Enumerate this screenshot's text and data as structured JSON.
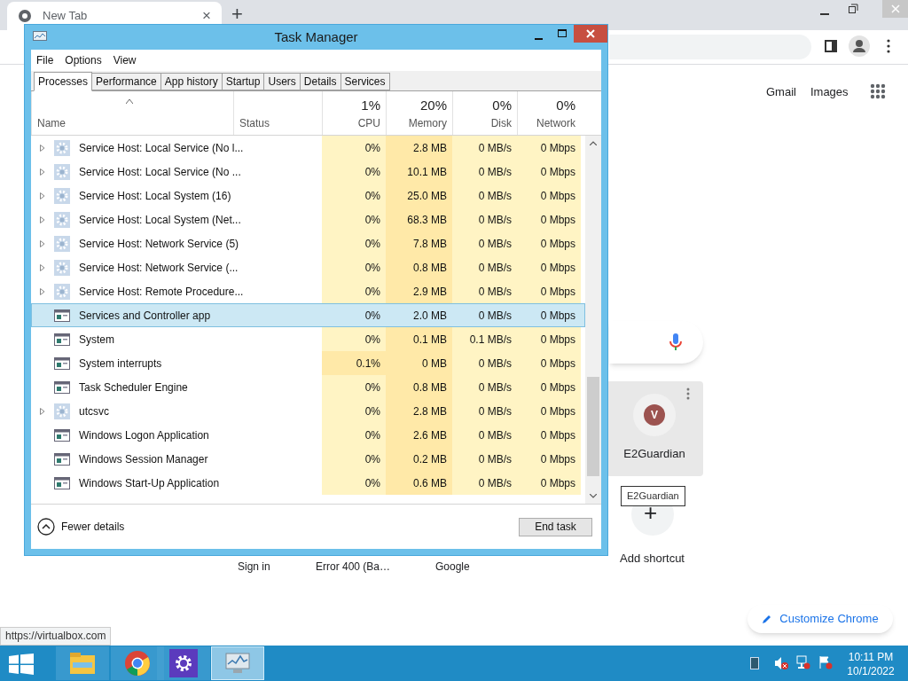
{
  "browser": {
    "tab": {
      "title": "New Tab",
      "close": "×"
    },
    "new_tab": "+",
    "top_links": [
      "Gmail",
      "Images"
    ],
    "shortcut": {
      "avatar": "V",
      "title": "E2Guardian",
      "tooltip": "E2Guardian"
    },
    "add_shortcut": "+",
    "add_shortcut_label": "Add shortcut",
    "hidden_shortcuts": [
      "Sign in",
      "Error 400 (Ba…",
      "Google"
    ],
    "customize": "Customize Chrome",
    "status_url": "https://virtualbox.com"
  },
  "task_manager": {
    "title": "Task Manager",
    "menu": [
      "File",
      "Options",
      "View"
    ],
    "tabs": [
      {
        "label": "Processes",
        "selected": true
      },
      {
        "label": "Performance",
        "selected": false
      },
      {
        "label": "App history",
        "selected": false
      },
      {
        "label": "Startup",
        "selected": false
      },
      {
        "label": "Users",
        "selected": false
      },
      {
        "label": "Details",
        "selected": false
      },
      {
        "label": "Services",
        "selected": false
      }
    ],
    "columns": [
      {
        "label": "Name"
      },
      {
        "label": "Status"
      },
      {
        "label": "CPU",
        "total": "1%"
      },
      {
        "label": "Memory",
        "total": "20%"
      },
      {
        "label": "Disk",
        "total": "0%"
      },
      {
        "label": "Network",
        "total": "0%"
      }
    ],
    "rows": [
      {
        "kind": "service",
        "name": "Service Host: Local Service (No l...",
        "cpu": "0%",
        "memory": "2.8 MB",
        "disk": "0 MB/s",
        "network": "0 Mbps",
        "selected": false
      },
      {
        "kind": "service",
        "name": "Service Host: Local Service (No ...",
        "cpu": "0%",
        "memory": "10.1 MB",
        "disk": "0 MB/s",
        "network": "0 Mbps",
        "selected": false
      },
      {
        "kind": "service",
        "name": "Service Host: Local System (16)",
        "cpu": "0%",
        "memory": "25.0 MB",
        "disk": "0 MB/s",
        "network": "0 Mbps",
        "selected": false
      },
      {
        "kind": "service",
        "name": "Service Host: Local System (Net...",
        "cpu": "0%",
        "memory": "68.3 MB",
        "disk": "0 MB/s",
        "network": "0 Mbps",
        "selected": false
      },
      {
        "kind": "service",
        "name": "Service Host: Network Service (5)",
        "cpu": "0%",
        "memory": "7.8 MB",
        "disk": "0 MB/s",
        "network": "0 Mbps",
        "selected": false
      },
      {
        "kind": "service",
        "name": "Service Host: Network Service (...",
        "cpu": "0%",
        "memory": "0.8 MB",
        "disk": "0 MB/s",
        "network": "0 Mbps",
        "selected": false
      },
      {
        "kind": "service",
        "name": "Service Host: Remote Procedure...",
        "cpu": "0%",
        "memory": "2.9 MB",
        "disk": "0 MB/s",
        "network": "0 Mbps",
        "selected": false
      },
      {
        "kind": "app",
        "name": "Services and Controller app",
        "cpu": "0%",
        "memory": "2.0 MB",
        "disk": "0 MB/s",
        "network": "0 Mbps",
        "selected": true
      },
      {
        "kind": "app",
        "name": "System",
        "cpu": "0%",
        "memory": "0.1 MB",
        "disk": "0.1 MB/s",
        "network": "0 Mbps",
        "selected": false
      },
      {
        "kind": "app",
        "name": "System interrupts",
        "cpu": "0.1%",
        "memory": "0 MB",
        "disk": "0 MB/s",
        "network": "0 Mbps",
        "selected": false
      },
      {
        "kind": "app",
        "name": "Task Scheduler Engine",
        "cpu": "0%",
        "memory": "0.8 MB",
        "disk": "0 MB/s",
        "network": "0 Mbps",
        "selected": false
      },
      {
        "kind": "service",
        "name": "utcsvc",
        "cpu": "0%",
        "memory": "2.8 MB",
        "disk": "0 MB/s",
        "network": "0 Mbps",
        "selected": false
      },
      {
        "kind": "app",
        "name": "Windows Logon Application",
        "cpu": "0%",
        "memory": "2.6 MB",
        "disk": "0 MB/s",
        "network": "0 Mbps",
        "selected": false
      },
      {
        "kind": "app",
        "name": "Windows Session Manager",
        "cpu": "0%",
        "memory": "0.2 MB",
        "disk": "0 MB/s",
        "network": "0 Mbps",
        "selected": false
      },
      {
        "kind": "app",
        "name": "Windows Start-Up Application",
        "cpu": "0%",
        "memory": "0.6 MB",
        "disk": "0 MB/s",
        "network": "0 Mbps",
        "selected": false
      }
    ],
    "fewer_details": "Fewer details",
    "end_task": "End task"
  },
  "taskbar": {
    "apps": [
      {
        "kind": "explorer",
        "active": false
      },
      {
        "kind": "chrome",
        "active": false
      },
      {
        "kind": "settings",
        "active": false
      },
      {
        "kind": "taskmgr",
        "active": true
      }
    ],
    "time": "10:11 PM",
    "date": "10/1/2022"
  }
}
